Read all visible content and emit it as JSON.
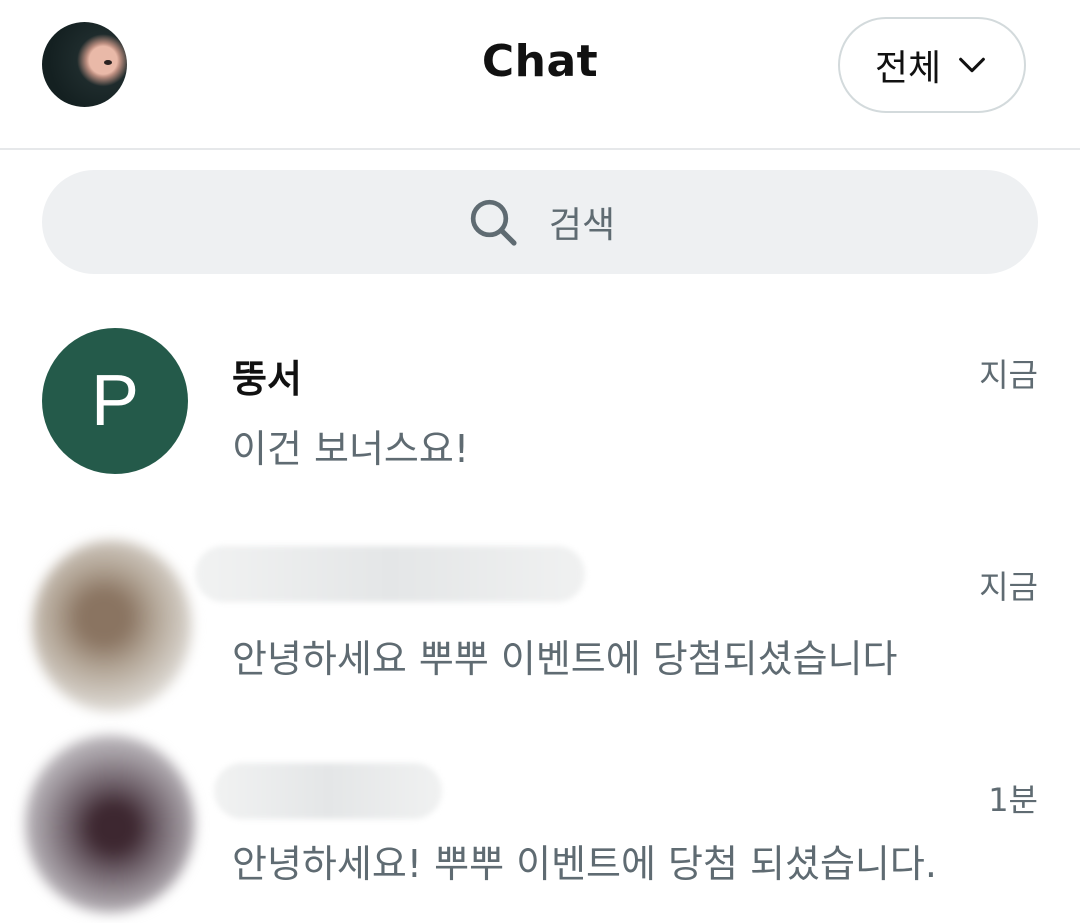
{
  "header": {
    "title": "Chat",
    "filter_label": "전체"
  },
  "search": {
    "placeholder": "검색"
  },
  "chats": [
    {
      "avatar_letter": "P",
      "avatar_color": "#245a4a",
      "name": "뚱서",
      "time": "지금",
      "message": "이건 보너스요!"
    },
    {
      "name": "",
      "time": "지금",
      "message": "안녕하세요 뿌뿌 이벤트에 당첨되셨습니다"
    },
    {
      "name": "",
      "time": "1분",
      "message": "안녕하세요! 뿌뿌 이벤트에 당첨 되셨습니다."
    }
  ],
  "colors": {
    "accent_avatar": "#245a4a",
    "muted_text": "#5f6b72",
    "search_bg": "#eef0f2"
  }
}
